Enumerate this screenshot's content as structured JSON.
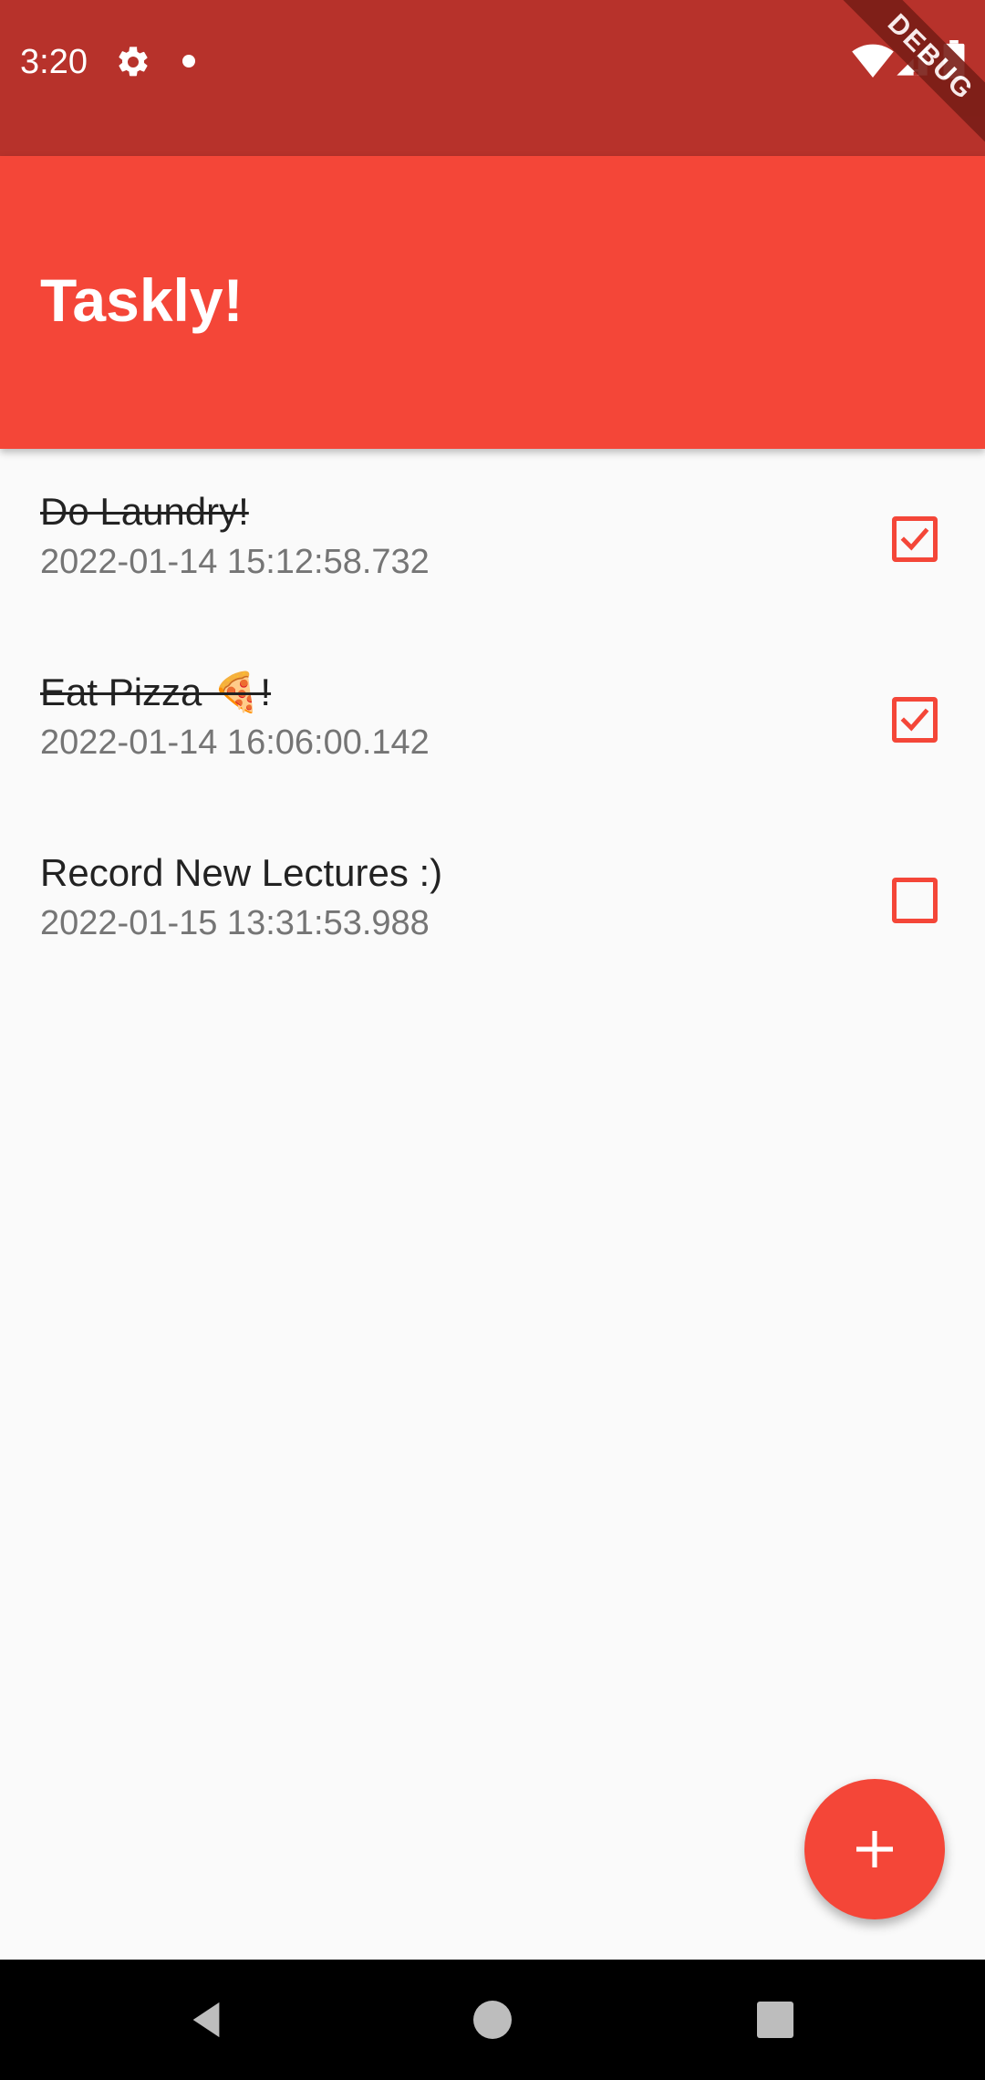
{
  "status_bar": {
    "time": "3:20",
    "icons": [
      "gear-icon",
      "notification-dot-icon",
      "wifi-icon",
      "signal-icon",
      "battery-icon"
    ]
  },
  "debug_banner": {
    "label": "DEBUG"
  },
  "app_bar": {
    "title": "Taskly!"
  },
  "tasks": [
    {
      "title": "Do Laundry!",
      "date": "2022-01-14 15:12:58.732",
      "done": true
    },
    {
      "title": "Eat Pizza 🍕!",
      "date": "2022-01-14 16:06:00.142",
      "done": true
    },
    {
      "title": "Record New Lectures :)",
      "date": "2022-01-15 13:31:53.988",
      "done": false
    }
  ],
  "fab": {
    "icon": "add-icon"
  },
  "nav_bar": {
    "icons": [
      "back-icon",
      "home-icon",
      "recents-icon"
    ]
  },
  "colors": {
    "status_bar": "#b7322b",
    "app_bar": "#f44638",
    "accent": "#f44638",
    "background": "#fafafa"
  }
}
